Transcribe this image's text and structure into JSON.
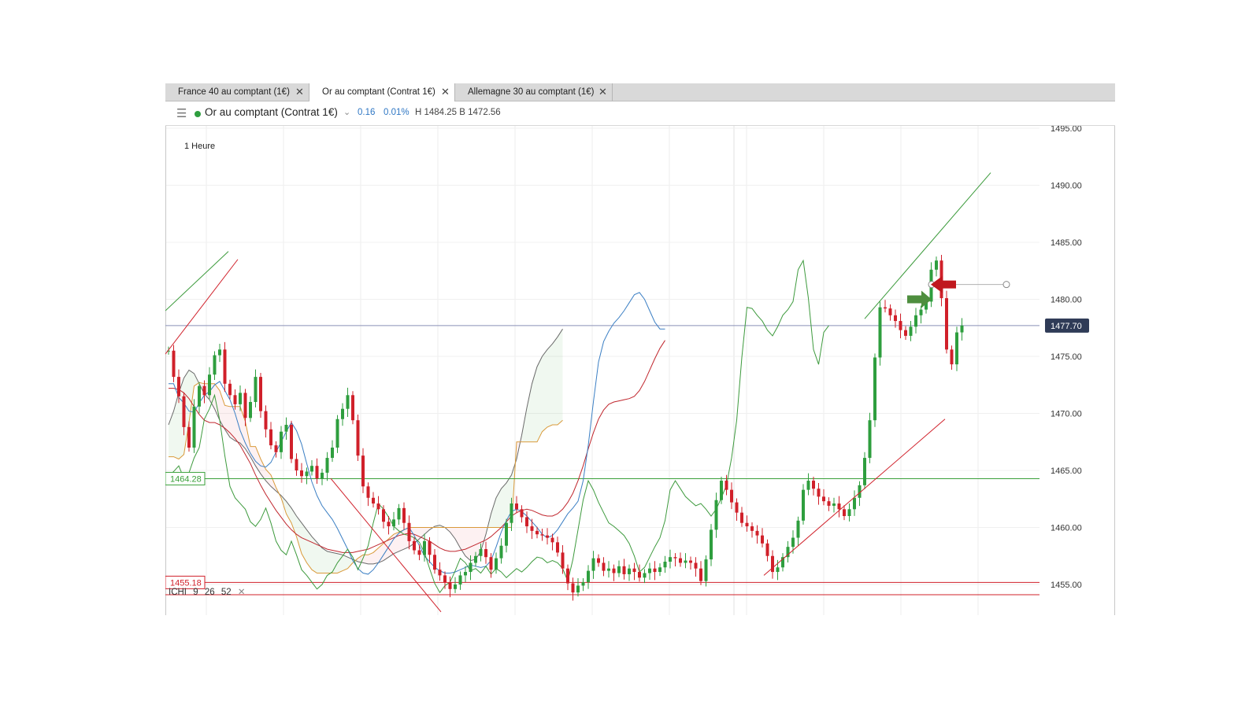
{
  "tabs": [
    {
      "label": "France 40 au comptant (1€)",
      "active": false
    },
    {
      "label": "Or au comptant (Contrat 1€)",
      "active": true
    },
    {
      "label": "Allemagne 30 au comptant (1€)",
      "active": false
    }
  ],
  "tab_close_glyph": "✕",
  "instrument": {
    "menu_icon": "hamburger-icon",
    "name": "Or au comptant (Contrat 1€)",
    "status_color": "#2e9e3e",
    "change": "0.16",
    "change_pct": "0.01%",
    "high_low": "H 1484.25  B 1472.56"
  },
  "timeframe": "1 Heure",
  "indicator": {
    "name": "ICHI",
    "p1": "9",
    "p2": "26",
    "p3": "52",
    "remove_glyph": "✕"
  },
  "price_axis": {
    "ticks": [
      "1495.00",
      "1490.00",
      "1485.00",
      "1480.00",
      "1475.00",
      "1470.00",
      "1465.00",
      "1460.00",
      "1455.00"
    ],
    "current_price": "1477.70",
    "support_label": "1464.28",
    "low_label": "1455.18"
  },
  "colors": {
    "bull": "#2e9e3e",
    "bear": "#d0202a",
    "tenkan": "#3b7fc4",
    "kijun": "#c0262d",
    "chikou": "#3d9a3d",
    "span_a": "#6a6a6a",
    "span_b": "#d99a3a",
    "current_line": "#8a90b8"
  },
  "chart_data": {
    "type": "candlestick",
    "timeframe": "1 Heure",
    "ylim": [
      1453.0,
      1496.0
    ],
    "current_price": 1477.7,
    "horizontal_levels": [
      1464.28,
      1455.18,
      1454.1
    ],
    "closes": [
      1475.5,
      1473.2,
      1471.5,
      1468.8,
      1467.0,
      1470.6,
      1472.4,
      1471.6,
      1473.4,
      1475.1,
      1475.6,
      1472.6,
      1471.6,
      1470.8,
      1471.8,
      1469.6,
      1471.0,
      1473.2,
      1470.2,
      1468.6,
      1467.2,
      1466.6,
      1468.4,
      1469.0,
      1466.0,
      1465.0,
      1464.5,
      1464.9,
      1465.4,
      1464.3,
      1464.8,
      1466.1,
      1467.0,
      1469.5,
      1470.4,
      1471.6,
      1469.4,
      1466.3,
      1463.6,
      1462.6,
      1462.1,
      1461.6,
      1460.5,
      1460.1,
      1460.7,
      1461.7,
      1460.4,
      1458.8,
      1458.0,
      1457.6,
      1458.8,
      1457.6,
      1456.3,
      1455.8,
      1455.2,
      1454.6,
      1455.0,
      1455.8,
      1456.1,
      1456.9,
      1457.5,
      1458.1,
      1457.4,
      1456.3,
      1457.3,
      1458.4,
      1460.4,
      1462.1,
      1461.6,
      1460.9,
      1460.1,
      1459.7,
      1459.4,
      1459.3,
      1459.1,
      1458.7,
      1457.8,
      1456.4,
      1455.1,
      1454.3,
      1454.9,
      1455.2,
      1456.2,
      1457.3,
      1456.9,
      1456.2,
      1456.4,
      1456.0,
      1456.6,
      1455.9,
      1456.4,
      1456.1,
      1455.6,
      1456.0,
      1456.4,
      1456.1,
      1456.5,
      1457.0,
      1457.4,
      1457.3,
      1456.9,
      1457.1,
      1456.9,
      1456.4,
      1455.3,
      1457.2,
      1459.8,
      1462.4,
      1464.1,
      1463.3,
      1462.2,
      1461.3,
      1460.4,
      1460.1,
      1459.7,
      1459.3,
      1458.6,
      1457.5,
      1456.1,
      1456.5,
      1457.4,
      1458.3,
      1459.1,
      1460.6,
      1463.3,
      1464.1,
      1463.4,
      1462.7,
      1462.3,
      1461.9,
      1462.1,
      1461.6,
      1461.0,
      1461.6,
      1462.6,
      1463.7,
      1466.1,
      1469.4,
      1474.9,
      1479.3,
      1479.2,
      1478.6,
      1478.1,
      1477.3,
      1476.8,
      1477.6,
      1478.6,
      1479.1,
      1479.8,
      1482.6,
      1483.4,
      1480.1,
      1475.6,
      1474.3,
      1477.1,
      1477.7
    ],
    "tenkan": [
      1472.6,
      1472.6,
      1471.4,
      1470.9,
      1470.2,
      1470.1,
      1470.9,
      1471.6,
      1471.9,
      1472.5,
      1472.8,
      1472.0,
      1471.2,
      1470.0,
      1468.5,
      1467.4,
      1466.5,
      1465.8,
      1465.4,
      1465.3,
      1465.7,
      1466.6,
      1467.5,
      1468.4,
      1469.2,
      1468.5,
      1467.3,
      1465.6,
      1464.0,
      1462.8,
      1461.9,
      1461.3,
      1460.7,
      1459.9,
      1459.0,
      1458.1,
      1457.1,
      1456.4,
      1456.0,
      1455.9,
      1456.3,
      1456.9,
      1457.6,
      1458.3,
      1459.0,
      1459.5,
      1459.8,
      1460.0,
      1459.3,
      1458.4,
      1457.5,
      1457.0,
      1456.5,
      1456.2,
      1456.0,
      1456.0,
      1456.1,
      1456.3,
      1456.5,
      1456.7,
      1456.6,
      1456.5,
      1456.6,
      1457.1,
      1458.3,
      1459.6,
      1460.6,
      1461.4,
      1461.6,
      1461.4,
      1461.0,
      1460.5,
      1460.0,
      1459.4,
      1459.1,
      1459.3,
      1459.8,
      1460.5,
      1461.2,
      1461.7,
      1462.3,
      1464.1,
      1467.2,
      1471.0,
      1474.5,
      1476.3,
      1477.2,
      1477.9,
      1478.4,
      1479.0,
      1479.7,
      1480.4,
      1480.6,
      1480.0,
      1479.0,
      1478.0,
      1477.4,
      1477.4
    ],
    "kijun": [
      1472.2,
      1472.2,
      1472.1,
      1471.8,
      1471.3,
      1470.6,
      1469.9,
      1469.4,
      1469.2,
      1469.2,
      1469.0,
      1468.7,
      1468.3,
      1467.8,
      1467.2,
      1466.4,
      1465.6,
      1464.6,
      1463.7,
      1462.9,
      1462.2,
      1461.5,
      1460.9,
      1460.3,
      1459.8,
      1459.4,
      1459.1,
      1458.9,
      1458.7,
      1458.5,
      1458.3,
      1458.1,
      1458.0,
      1457.9,
      1457.8,
      1457.8,
      1457.8,
      1457.9,
      1458.0,
      1458.1,
      1458.3,
      1458.5,
      1458.7,
      1458.9,
      1459.1,
      1459.3,
      1459.4,
      1459.5,
      1459.4,
      1459.2,
      1459.0,
      1458.8,
      1458.5,
      1458.2,
      1458.0,
      1457.9,
      1457.9,
      1458.0,
      1458.1,
      1458.3,
      1458.5,
      1458.7,
      1458.9,
      1459.2,
      1459.6,
      1460.0,
      1460.5,
      1461.0,
      1461.3,
      1461.5,
      1461.6,
      1461.5,
      1461.3,
      1461.1,
      1461.0,
      1461.0,
      1461.2,
      1461.6,
      1462.2,
      1463.0,
      1464.1,
      1465.4,
      1466.9,
      1468.3,
      1469.5,
      1470.3,
      1470.8,
      1471.0,
      1471.1,
      1471.2,
      1471.3,
      1471.5,
      1472.0,
      1472.8,
      1473.8,
      1474.8,
      1475.7,
      1476.4
    ],
    "senkou_span_a": [
      1469.0,
      1470.2,
      1471.8,
      1473.1,
      1473.8,
      1473.5,
      1472.6,
      1471.7,
      1471.2,
      1470.4,
      1469.4,
      1468.6,
      1467.9,
      1467.6,
      1467.4,
      1466.9,
      1466.2,
      1465.4,
      1464.7,
      1464.1,
      1463.6,
      1463.2,
      1462.8,
      1462.3,
      1461.7,
      1461.0,
      1460.4,
      1459.8,
      1459.2,
      1458.7,
      1458.2,
      1457.9,
      1457.8,
      1457.7,
      1457.6,
      1457.4,
      1457.2,
      1457.0,
      1456.9,
      1456.8,
      1456.8,
      1456.9,
      1457.1,
      1457.4,
      1457.7,
      1457.9,
      1458.1,
      1458.3,
      1458.6,
      1459.0,
      1459.4,
      1459.8,
      1460.1,
      1460.2,
      1460.0,
      1459.6,
      1459.0,
      1458.2,
      1457.5,
      1457.1,
      1457.2,
      1457.9,
      1459.4,
      1461.2,
      1462.6,
      1463.4,
      1463.9,
      1464.6,
      1466.0,
      1468.1,
      1470.5,
      1472.6,
      1474.1,
      1475.0,
      1475.6,
      1476.1,
      1476.7,
      1477.4
    ],
    "senkou_span_b": [
      1466.2,
      1466.2,
      1466.0,
      1466.4,
      1469.2,
      1472.4,
      1472.7,
      1472.6,
      1472.6,
      1472.6,
      1472.0,
      1470.7,
      1470.6,
      1470.6,
      1470.6,
      1469.3,
      1467.1,
      1467.1,
      1466.0,
      1465.1,
      1464.6,
      1463.5,
      1462.6,
      1461.2,
      1460.4,
      1459.2,
      1457.7,
      1456.9,
      1456.3,
      1456.0,
      1456.0,
      1456.0,
      1456.0,
      1456.0,
      1456.2,
      1456.4,
      1456.9,
      1457.3,
      1457.6,
      1457.6,
      1457.8,
      1458.2,
      1458.6,
      1459.0,
      1459.4,
      1459.6,
      1459.8,
      1460.0,
      1460.0,
      1460.0,
      1460.0,
      1460.0,
      1460.0,
      1460.0,
      1460.0,
      1460.0,
      1460.0,
      1460.0,
      1460.0,
      1460.0,
      1460.0,
      1460.0,
      1460.0,
      1460.0,
      1460.0,
      1460.0,
      1460.0,
      1460.0,
      1467.5,
      1467.5,
      1467.5,
      1467.5,
      1467.5,
      1468.4,
      1468.8,
      1469.0,
      1469.0,
      1469.4
    ]
  }
}
